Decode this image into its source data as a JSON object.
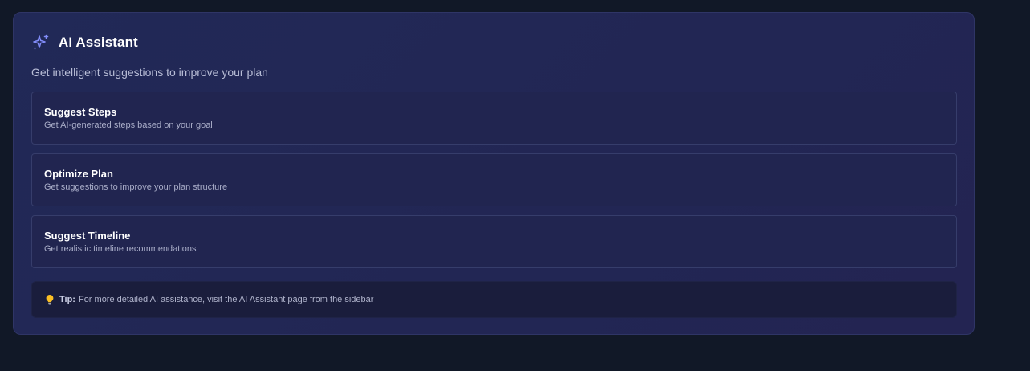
{
  "assistant": {
    "title": "AI Assistant",
    "subtitle": "Get intelligent suggestions to improve your plan",
    "icon": "sparkles-icon",
    "accent_color": "#818cf8"
  },
  "options": [
    {
      "title": "Suggest Steps",
      "description": "Get AI-generated steps based on your goal"
    },
    {
      "title": "Optimize Plan",
      "description": "Get suggestions to improve your plan structure"
    },
    {
      "title": "Suggest Timeline",
      "description": "Get realistic timeline recommendations"
    }
  ],
  "tip": {
    "icon": "lightbulb-icon",
    "label": "Tip:",
    "text": "For more detailed AI assistance, visit the AI Assistant page from the sidebar"
  }
}
